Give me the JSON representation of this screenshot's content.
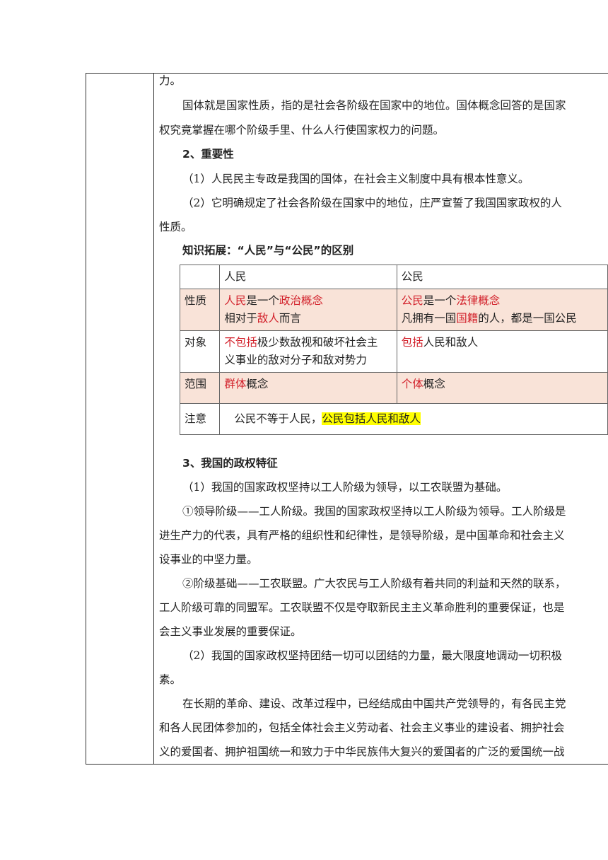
{
  "lines": {
    "l1": "力。",
    "l2": "国体就是国家性质，指的是社会各阶级在国家中的地位。国体概念回答的是国家",
    "l3": "权究竟掌握在哪个阶级手里、什么人行使国家权力的问题。",
    "l4": "2、重要性",
    "l5": "（1）人民民主专政是我国的国体，在社会主义制度中具有根本性意义。",
    "l6": "（2）它明确规定了社会各阶级在国家中的地位，庄严宣誓了我国国家政权的人",
    "l7": "性质。",
    "l8": "知识拓展：“人民”与“公民”的区别",
    "l9": "3、我国的政权特征",
    "l10": "（1）我国的国家政权坚持以工人阶级为领导，以工农联盟为基础。",
    "l11": "①领导阶级——工人阶级。我国的国家政权坚持以工人阶级为领导。工人阶级是",
    "l12": "进生产力的代表，具有严格的组织性和纪律性，是领导阶级，是中国革命和社会主义",
    "l13": "设事业的中坚力量。",
    "l14": "②阶级基础——工农联盟。广大农民与工人阶级有着共同的利益和天然的联系，",
    "l15": "工人阶级可靠的同盟军。工农联盟不仅是夺取新民主主义革命胜利的重要保证，也是",
    "l16": "会主义事业发展的重要保证。",
    "l17": "（2）我国的国家政权坚持团结一切可以团结的力量，最大限度地调动一切积极",
    "l18": "素。",
    "l19": "在长期的革命、建设、改革过程中，已经结成由中国共产党领导的，有各民主党",
    "l20": "和各人民团体参加的，包括全体社会主义劳动者、社会主义事业的建设者、拥护社会",
    "l21": "义的爱国者、拥护祖国统一和致力于中华民族伟大复兴的爱国者的广泛的爱国统一战"
  },
  "table": {
    "header": [
      "",
      "人民",
      "公民"
    ],
    "nature": {
      "label": "性质",
      "p_red1": "人民",
      "p_mid1": "是一个",
      "p_red2": "政治概念",
      "p_line2a": "相对于",
      "p_red3": "敌人",
      "p_line2b": "而言",
      "c_red1": "公民",
      "c_mid1": "是一个",
      "c_red2": "法律概念",
      "c_line2a": "凡拥有一国",
      "c_red3": "国籍",
      "c_line2b": "的人，都是一国公民"
    },
    "object": {
      "label": "对象",
      "p_red": "不包括",
      "p_rest1": "极少数敌视和破坏社会主",
      "p_line2": "义事业的敌对分子和敌对势力",
      "c_red": "包括",
      "c_rest": "人民和敌人"
    },
    "scope": {
      "label": "范围",
      "p_red": "群体",
      "p_rest": "概念",
      "c_red": "个体",
      "c_rest": "概念"
    },
    "note": {
      "label": "注意",
      "text": "公民不等于人民，",
      "highlight": "公民包括人民和敌人"
    }
  },
  "colors": {
    "red_text": "#d2202a",
    "highlight": "#ffff00",
    "row_shade": "#f9e3d8"
  }
}
